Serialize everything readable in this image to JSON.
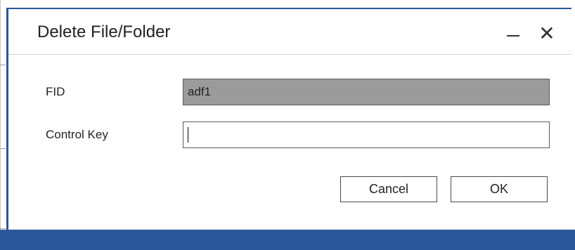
{
  "dialog": {
    "title": "Delete File/Folder",
    "minimize_icon": "minimize-icon",
    "close_icon": "close-icon",
    "close_glyph": "✕"
  },
  "form": {
    "fid_label": "FID",
    "fid_value": "adf1",
    "control_key_label": "Control Key",
    "control_key_value": ""
  },
  "buttons": {
    "cancel_label": "Cancel",
    "ok_label": "OK"
  },
  "colors": {
    "accent": "#2b579a",
    "disabled_field": "#9b9b9b"
  }
}
